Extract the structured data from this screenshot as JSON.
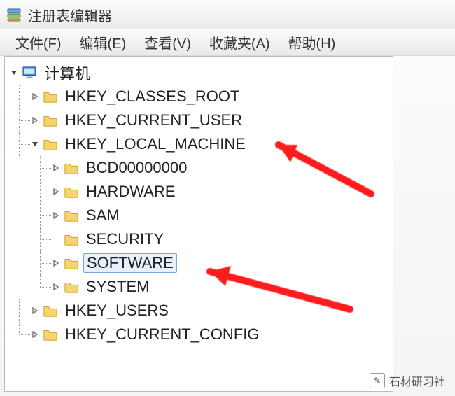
{
  "window": {
    "title": "注册表编辑器"
  },
  "menu": {
    "file": "文件(F)",
    "edit": "编辑(E)",
    "view": "查看(V)",
    "favorites": "收藏夹(A)",
    "help": "帮助(H)"
  },
  "tree": {
    "root": "计算机",
    "hkcr": "HKEY_CLASSES_ROOT",
    "hkcu": "HKEY_CURRENT_USER",
    "hklm": "HKEY_LOCAL_MACHINE",
    "hklm_children": {
      "bcd": "BCD00000000",
      "hardware": "HARDWARE",
      "sam": "SAM",
      "security": "SECURITY",
      "software": "SOFTWARE",
      "system": "SYSTEM"
    },
    "hku": "HKEY_USERS",
    "hkcc": "HKEY_CURRENT_CONFIG"
  },
  "watermark": {
    "text": "石材研习社",
    "icon_glyph": "✎"
  }
}
